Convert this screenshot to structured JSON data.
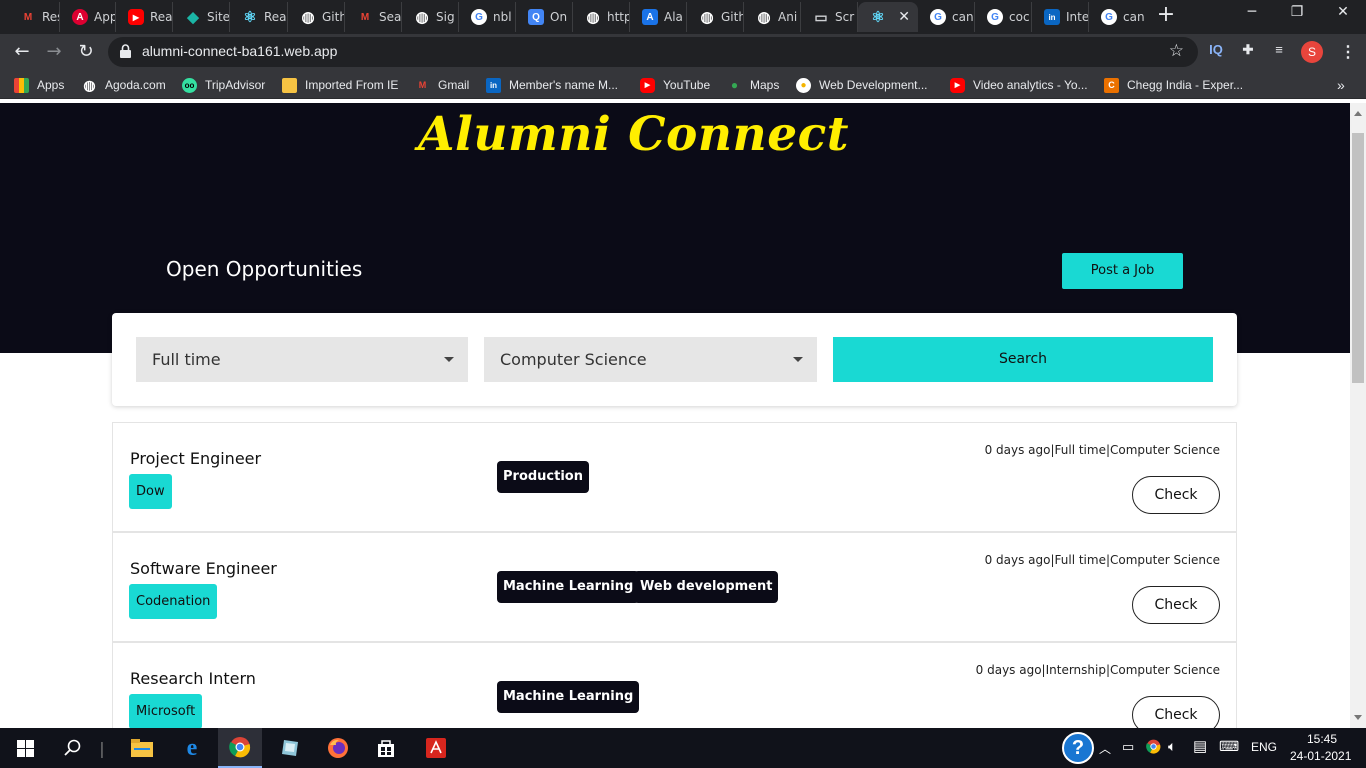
{
  "tabs": [
    {
      "label": "Res",
      "icon": "gmail-icon",
      "color": "#ea4335",
      "glyph": "M"
    },
    {
      "label": "App",
      "icon": "angular-icon",
      "color": "#dd0031",
      "glyph": "A"
    },
    {
      "label": "Rea",
      "icon": "youtube-icon",
      "color": "#ff0000",
      "glyph": "▶"
    },
    {
      "label": "Site",
      "icon": "diamond-icon",
      "color": "#1bb5a5",
      "glyph": "◆"
    },
    {
      "label": "Rea",
      "icon": "react-icon",
      "color": "#61dafb",
      "glyph": "⚛"
    },
    {
      "label": "Gith",
      "icon": "globe-icon",
      "color": "#ffffff",
      "glyph": "◍"
    },
    {
      "label": "Sea",
      "icon": "gmail-icon",
      "color": "#ea4335",
      "glyph": "M"
    },
    {
      "label": "Sig",
      "icon": "globe-icon",
      "color": "#ffffff",
      "glyph": "◍"
    },
    {
      "label": "nbl",
      "icon": "google-icon",
      "color": "#4285f4",
      "glyph": "G"
    },
    {
      "label": "On",
      "icon": "search-doc-icon",
      "color": "#4285f4",
      "glyph": "Q"
    },
    {
      "label": "http",
      "icon": "globe-icon",
      "color": "#ffffff",
      "glyph": "◍"
    },
    {
      "label": "Ala",
      "icon": "azure-icon",
      "color": "#1a73e8",
      "glyph": "A"
    },
    {
      "label": "Gith",
      "icon": "globe-icon",
      "color": "#ffffff",
      "glyph": "◍"
    },
    {
      "label": "Ani",
      "icon": "globe-icon",
      "color": "#ffffff",
      "glyph": "◍"
    },
    {
      "label": "Scr",
      "icon": "monitor-icon",
      "color": "#cfd1d4",
      "glyph": "▭"
    },
    {
      "label": "",
      "icon": "react-icon",
      "color": "#61dafb",
      "glyph": "⚛"
    },
    {
      "label": "can",
      "icon": "google-icon",
      "color": "#4285f4",
      "glyph": "G"
    },
    {
      "label": "coc",
      "icon": "google-icon",
      "color": "#4285f4",
      "glyph": "G"
    },
    {
      "label": "Inte",
      "icon": "linkedin-icon",
      "color": "#0a66c2",
      "glyph": "in"
    },
    {
      "label": "can",
      "icon": "google-icon",
      "color": "#4285f4",
      "glyph": "G"
    }
  ],
  "browser": {
    "url": "alumni-connect-ba161.web.app",
    "profile_initial": "S",
    "ext_iq": "IQ"
  },
  "bookmarks": [
    {
      "label": "Apps",
      "icon": "apps-grid-icon",
      "color": "#e8453c",
      "glyph": "⁞⁞"
    },
    {
      "label": "Agoda.com",
      "icon": "globe-icon",
      "color": "#ffffff",
      "glyph": "◍"
    },
    {
      "label": "TripAdvisor",
      "icon": "tripadvisor-icon",
      "color": "#34e0a1",
      "glyph": "oo"
    },
    {
      "label": "Imported From IE",
      "icon": "folder-icon",
      "color": "#f6c343",
      "glyph": ""
    },
    {
      "label": "Gmail",
      "icon": "gmail-icon",
      "color": "#ea4335",
      "glyph": "M"
    },
    {
      "label": "Member's name M...",
      "icon": "linkedin-icon",
      "color": "#0a66c2",
      "glyph": "in"
    },
    {
      "label": "YouTube",
      "icon": "youtube-icon",
      "color": "#ff0000",
      "glyph": "▶"
    },
    {
      "label": "Maps",
      "icon": "maps-pin-icon",
      "color": "#34a853",
      "glyph": "●"
    },
    {
      "label": "Web Development...",
      "icon": "badge-icon",
      "color": "#f4b400",
      "glyph": "●"
    },
    {
      "label": "Video analytics - Yo...",
      "icon": "youtube-icon",
      "color": "#ff0000",
      "glyph": "▶"
    },
    {
      "label": "Chegg India - Exper...",
      "icon": "chegg-icon",
      "color": "#eb7100",
      "glyph": "C"
    }
  ],
  "page": {
    "brand": "Alumni Connect",
    "section_title": "Open Opportunities",
    "post_job_label": "Post a Job",
    "filters": {
      "job_type": "Full time",
      "department": "Computer Science",
      "search_label": "Search"
    },
    "jobs": [
      {
        "title": "Project Engineer",
        "company": "Dow",
        "tags": [
          "Production"
        ],
        "meta": "0 days ago|Full time|Computer Science",
        "action": "Check"
      },
      {
        "title": "Software Engineer",
        "company": "Codenation",
        "tags": [
          "Machine Learning",
          "Web development"
        ],
        "meta": "0 days ago|Full time|Computer Science",
        "action": "Check"
      },
      {
        "title": "Research Intern",
        "company": "Microsoft",
        "tags": [
          "Machine Learning"
        ],
        "meta": "0 days ago|Internship|Computer Science",
        "action": "Check"
      }
    ]
  },
  "taskbar": {
    "language": "ENG",
    "time": "15:45",
    "date": "24-01-2021"
  }
}
